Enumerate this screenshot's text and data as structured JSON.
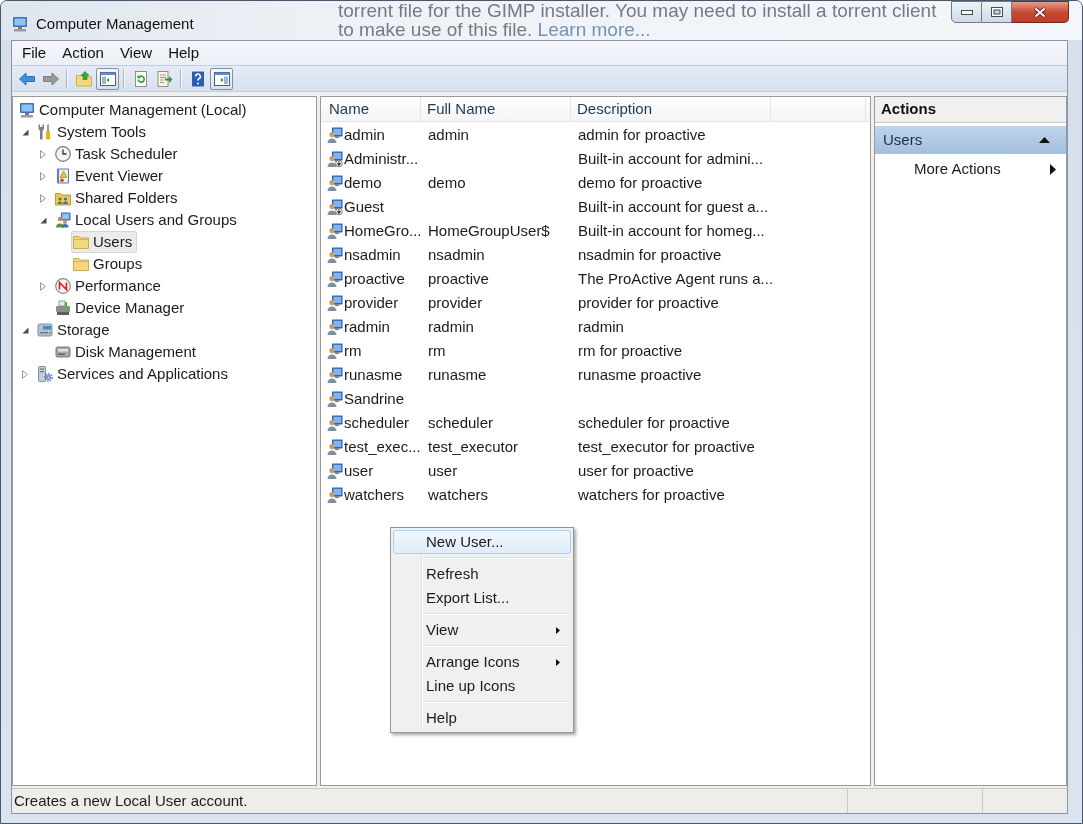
{
  "background_page": {
    "lines": [
      "torrent file for the GIMP installer. You may need to install a torrent client",
      "to make use of this file."
    ],
    "link": "Learn more..."
  },
  "window": {
    "title": "Computer Management"
  },
  "menu_bar": [
    "File",
    "Action",
    "View",
    "Help"
  ],
  "toolbar": [
    [
      {
        "kind": "back",
        "disabled": false,
        "pressed": false
      },
      {
        "kind": "forward",
        "disabled": true,
        "pressed": false
      }
    ],
    [
      {
        "kind": "up",
        "disabled": false,
        "pressed": false
      },
      {
        "kind": "console_tree",
        "disabled": false,
        "pressed": true
      }
    ],
    [
      {
        "kind": "refresh",
        "disabled": false,
        "pressed": false
      },
      {
        "kind": "export_list",
        "disabled": false,
        "pressed": false
      }
    ],
    [
      {
        "kind": "help",
        "disabled": false,
        "pressed": false
      },
      {
        "kind": "action_pane",
        "disabled": false,
        "pressed": true
      }
    ]
  ],
  "tree": [
    {
      "label": "Computer Management (Local)",
      "selected": false,
      "children": [
        {
          "label": "System Tools",
          "expanded": true,
          "selected": false,
          "children": [
            {
              "label": "Task Scheduler",
              "expanded": false,
              "selected": false
            },
            {
              "label": "Event Viewer",
              "expanded": false,
              "selected": false
            },
            {
              "label": "Shared Folders",
              "expanded": false,
              "selected": false
            },
            {
              "label": "Local Users and Groups",
              "expanded": true,
              "selected": false,
              "children": [
                {
                  "label": "Users",
                  "selected": true
                },
                {
                  "label": "Groups",
                  "selected": false
                }
              ]
            },
            {
              "label": "Performance",
              "expanded": false,
              "selected": false
            },
            {
              "label": "Device Manager",
              "selected": false
            }
          ]
        },
        {
          "label": "Storage",
          "expanded": true,
          "selected": false,
          "children": [
            {
              "label": "Disk Management",
              "selected": false
            }
          ]
        },
        {
          "label": "Services and Applications",
          "expanded": false,
          "selected": false
        }
      ]
    }
  ],
  "list": {
    "columns": [
      "Name",
      "Full Name",
      "Description"
    ],
    "rows": [
      {
        "name": "admin",
        "full_name": "admin",
        "description": "admin for proactive",
        "disabled": false,
        "selected": false
      },
      {
        "name": "Administr...",
        "description": "Built-in account for admini...",
        "disabled": true,
        "selected": false
      },
      {
        "name": "demo",
        "full_name": "demo",
        "description": "demo for proactive",
        "disabled": false,
        "selected": false
      },
      {
        "name": "Guest",
        "description": "Built-in account for guest a...",
        "disabled": true,
        "selected": false
      },
      {
        "name": "HomeGro...",
        "full_name": "HomeGroupUser$",
        "description": "Built-in account for homeg...",
        "disabled": false,
        "selected": false
      },
      {
        "name": "nsadmin",
        "full_name": "nsadmin",
        "description": "nsadmin for proactive",
        "disabled": false,
        "selected": false
      },
      {
        "name": "proactive",
        "full_name": "proactive",
        "description": "The ProActive Agent runs a...",
        "disabled": false,
        "selected": false
      },
      {
        "name": "provider",
        "full_name": "provider",
        "description": "provider for proactive",
        "disabled": false,
        "selected": false
      },
      {
        "name": "radmin",
        "full_name": "radmin",
        "description": "radmin",
        "disabled": false,
        "selected": false
      },
      {
        "name": "rm",
        "full_name": "rm",
        "description": "rm for proactive",
        "disabled": false,
        "selected": false
      },
      {
        "name": "runasme",
        "full_name": "runasme",
        "description": "runasme proactive",
        "disabled": false,
        "selected": false
      },
      {
        "name": "Sandrine",
        "disabled": false,
        "selected": false
      },
      {
        "name": "scheduler",
        "full_name": "scheduler",
        "description": "scheduler for proactive",
        "disabled": false,
        "selected": false
      },
      {
        "name": "test_exec...",
        "full_name": "test_executor",
        "description": "test_executor for proactive",
        "disabled": false,
        "selected": false
      },
      {
        "name": "user",
        "full_name": "user",
        "description": "user for proactive",
        "disabled": false,
        "selected": false
      },
      {
        "name": "watchers",
        "full_name": "watchers",
        "description": "watchers for proactive",
        "disabled": false,
        "selected": false
      }
    ]
  },
  "context_menu": {
    "groups": [
      [
        {
          "label": "New User...",
          "selected": true,
          "submenu": false
        }
      ],
      [
        {
          "label": "Refresh",
          "selected": false,
          "submenu": false
        },
        {
          "label": "Export List...",
          "selected": false,
          "submenu": false
        }
      ],
      [
        {
          "label": "View",
          "selected": false,
          "submenu": true
        }
      ],
      [
        {
          "label": "Arrange Icons",
          "selected": false,
          "submenu": true
        },
        {
          "label": "Line up Icons",
          "selected": false,
          "submenu": false
        }
      ],
      [
        {
          "label": "Help",
          "selected": false,
          "submenu": false
        }
      ]
    ]
  },
  "actions": {
    "title": "Actions",
    "sections": [
      {
        "label": "Users",
        "expanded": true,
        "items": [
          {
            "label": "More Actions",
            "submenu": true
          }
        ]
      }
    ]
  },
  "status_bar": {
    "text": "Creates a new Local User account."
  }
}
